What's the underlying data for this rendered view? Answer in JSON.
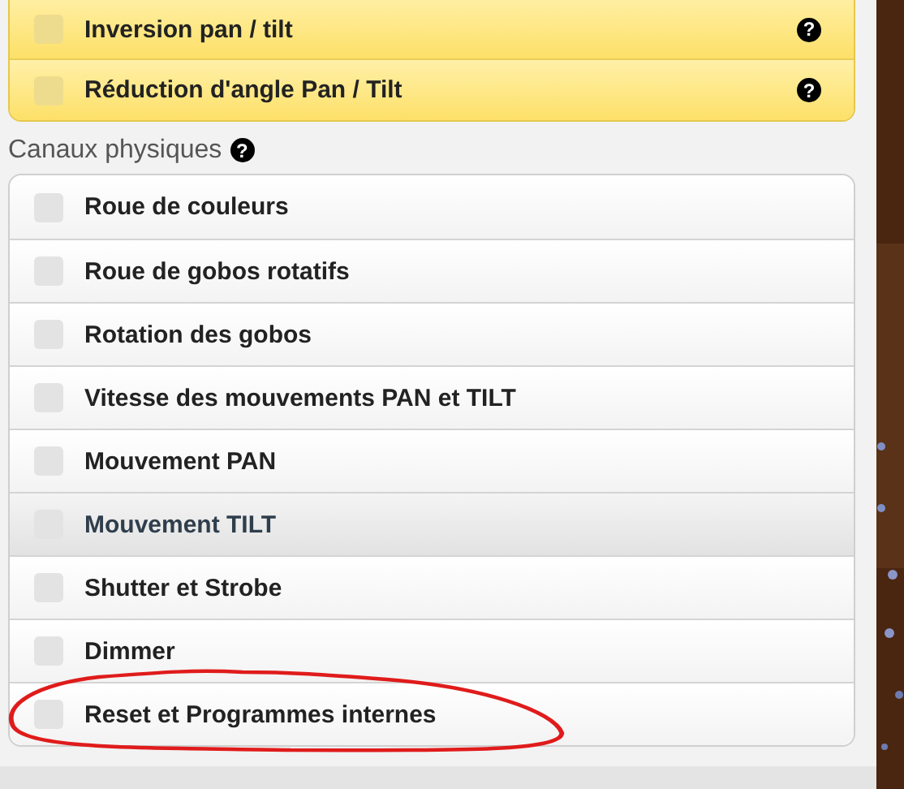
{
  "advanced_options": [
    {
      "label": "Inversion pan / tilt",
      "checked": false,
      "help": "?"
    },
    {
      "label": "Réduction d'angle Pan / Tilt",
      "checked": false,
      "help": "?"
    }
  ],
  "physical_channels": {
    "title": "Canaux physiques",
    "help": "?",
    "items": [
      {
        "label": "Roue de couleurs",
        "checked": false,
        "highlighted": false,
        "circled": false
      },
      {
        "label": "Roue de gobos rotatifs",
        "checked": false,
        "highlighted": false,
        "circled": false
      },
      {
        "label": "Rotation des gobos",
        "checked": false,
        "highlighted": false,
        "circled": false
      },
      {
        "label": "Vitesse des mouvements PAN et TILT",
        "checked": false,
        "highlighted": false,
        "circled": false
      },
      {
        "label": "Mouvement PAN",
        "checked": false,
        "highlighted": false,
        "circled": false
      },
      {
        "label": "Mouvement TILT",
        "checked": false,
        "highlighted": true,
        "circled": false
      },
      {
        "label": "Shutter et Strobe",
        "checked": false,
        "highlighted": false,
        "circled": false
      },
      {
        "label": "Dimmer",
        "checked": false,
        "highlighted": false,
        "circled": false
      },
      {
        "label": "Reset et Programmes internes",
        "checked": false,
        "highlighted": false,
        "circled": true
      }
    ]
  }
}
